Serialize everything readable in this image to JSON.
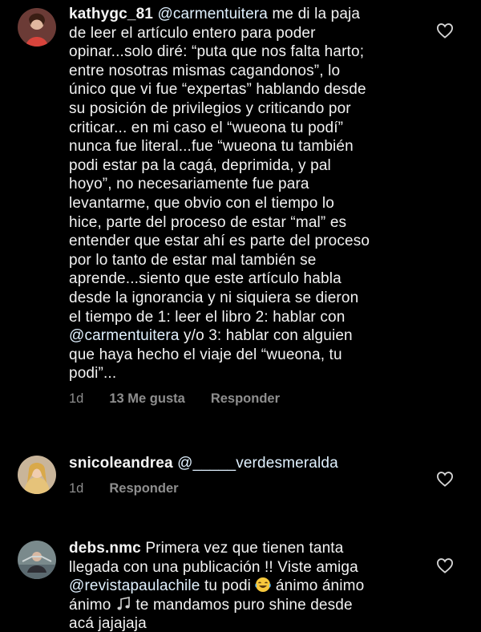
{
  "comments": [
    {
      "username": "kathygc_81",
      "mention": "@carmentuitera",
      "text_line1_rest": " me di la paja",
      "text_body": "de leer el artículo entero para poder\nopinar...solo diré: “puta que nos falta harto;\nentre nosotras mismas cagandonos”, lo\núnico que vi fue “expertas” hablando desde\nsu posición de privilegios y criticando por\ncriticar... en mi caso el “wueona tu podí”\nnunca fue literal...fue “wueona tu también\npodi estar pa la cagá, deprimida, y pal\nhoyo”, no necesariamente fue para\nlevantarme, que obvio con el tiempo lo\nhice, parte del proceso de estar “mal” es\nentender que estar ahí es parte del proceso\npor lo tanto de estar mal también se\naprende...siento que este artículo habla\ndesde la ignorancia y ni siquiera se dieron\nel tiempo de 1: leer el libro 2: hablar con\n",
      "mention2": "@carmentuitera",
      "text_tail": " y/o 3: hablar con alguien\nque haya hecho el viaje del “wueona, tu\npodi”...",
      "time": "1d",
      "likes": "13 Me gusta",
      "reply": "Responder"
    },
    {
      "username": "snicoleandrea",
      "mention": "@_____verdesmeralda",
      "time": "1d",
      "reply": "Responder"
    },
    {
      "username": "debs.nmc",
      "text_a": " Primera vez que tienen tanta\nllegada con una publicación !! Viste amiga\n",
      "mention": "@revistapaulachile",
      "text_b": " tu podi ",
      "text_c": " ánimo ánimo\nánimo ",
      "text_d": " te mandamos puro shine desde\nacá jajajaja"
    }
  ],
  "colors": {
    "background": "#000000",
    "text": "#f2f2f2",
    "secondary": "#8e8e8e",
    "mention": "#e0f1ff"
  },
  "icons": [
    "heart-icon",
    "laughing-emoji",
    "musical-notes-emoji"
  ]
}
